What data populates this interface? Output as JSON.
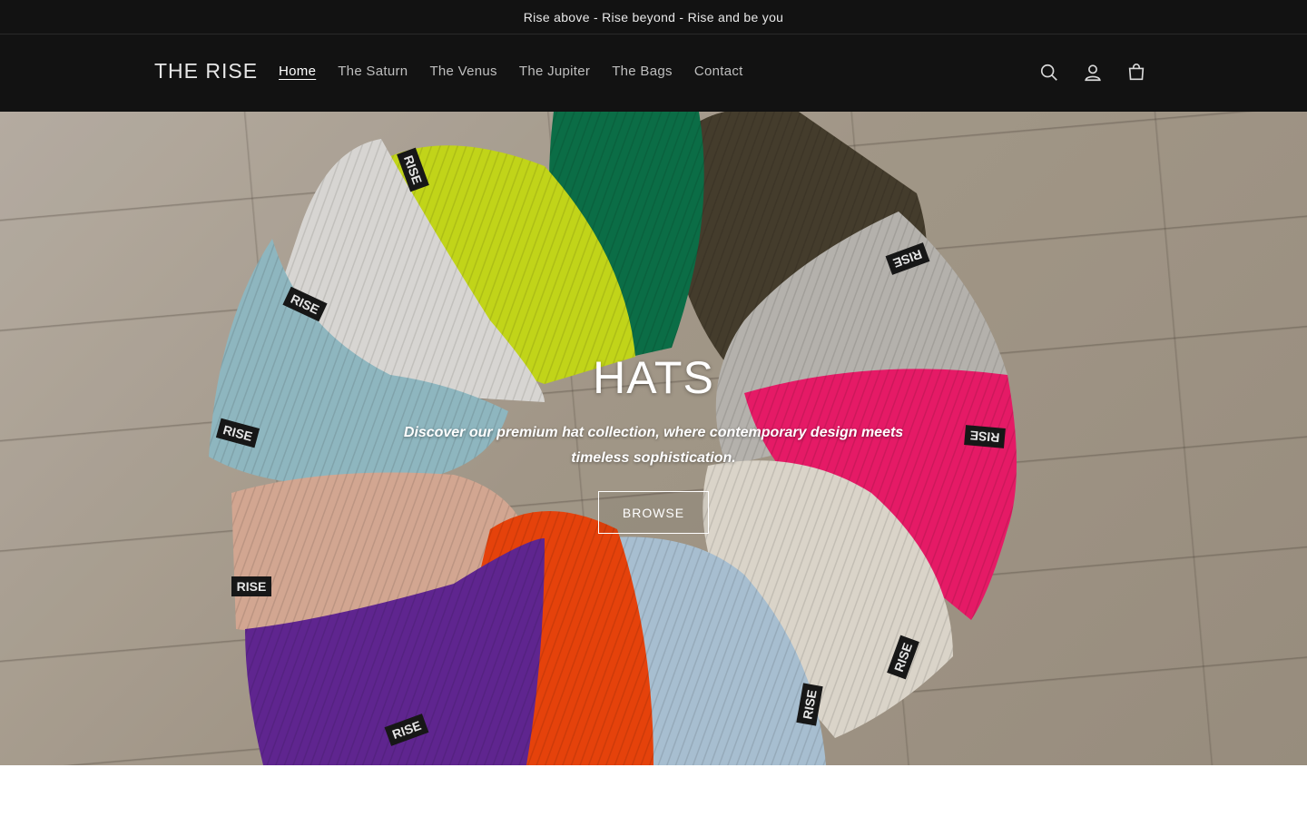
{
  "announcement": {
    "text": "Rise above - Rise beyond - Rise and be you"
  },
  "header": {
    "logo": "THE RISE",
    "nav": [
      {
        "label": "Home",
        "active": true
      },
      {
        "label": "The Saturn",
        "active": false
      },
      {
        "label": "The Venus",
        "active": false
      },
      {
        "label": "The Jupiter",
        "active": false
      },
      {
        "label": "The Bags",
        "active": false
      },
      {
        "label": "Contact",
        "active": false
      }
    ],
    "icons": [
      "search-icon",
      "account-icon",
      "cart-icon"
    ]
  },
  "hero": {
    "title": "HATS",
    "subtitle": "Discover our premium hat collection, where contemporary design meets timeless sophistication.",
    "button_label": "BROWSE",
    "hat_label": "RISE"
  },
  "colors": {
    "header_bg": "#121212",
    "text_light": "#ffffff",
    "nav_muted": "#bfbfbf"
  }
}
